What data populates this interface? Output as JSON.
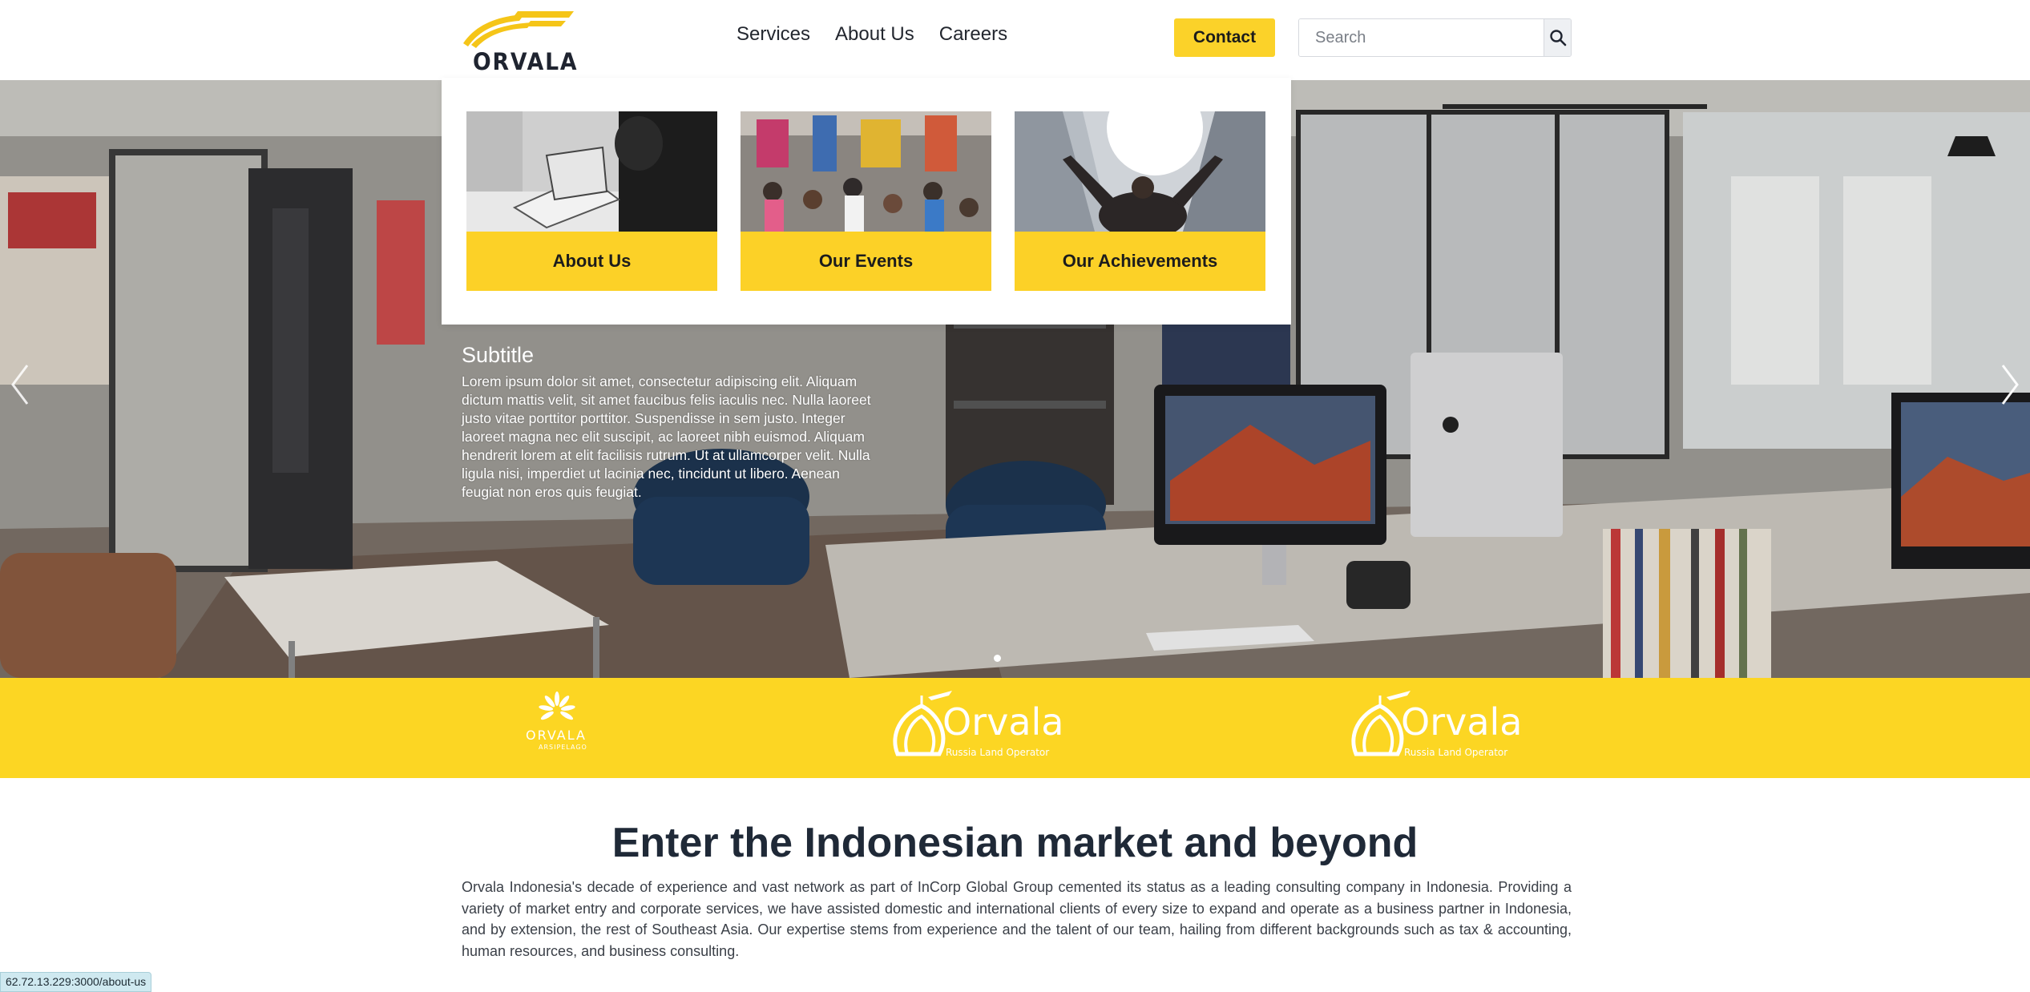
{
  "header": {
    "logo_text": "ORVALA",
    "nav": [
      "Services",
      "About Us",
      "Careers"
    ],
    "contact_label": "Contact",
    "search_placeholder": "Search"
  },
  "dropdown": {
    "cards": [
      {
        "label": "About Us",
        "image": "person-laptop-photo"
      },
      {
        "label": "Our Events",
        "image": "event-crowd-photo"
      },
      {
        "label": "Our Achievements",
        "image": "celebrating-man-skyscrapers-photo"
      }
    ]
  },
  "hero": {
    "subtitle": "Subtitle",
    "text": "Lorem ipsum dolor sit amet, consectetur adipiscing elit. Aliquam dictum mattis velit, sit amet faucibus felis iaculis nec. Nulla laoreet justo vitae porttitor porttitor. Suspendisse in sem justo. Integer laoreet magna nec elit suscipit, ac laoreet nibh euismod. Aliquam hendrerit lorem at elit facilisis rutrum. Ut at ullamcorper velit. Nulla ligula nisi, imperdiet ut lacinia nec, tincidunt ut libero. Aenean feugiat non eros quis feugiat.",
    "slide_count": 1,
    "active_slide": 1
  },
  "partners": [
    {
      "name": "ORVALA",
      "sub": "ARSIPELAGO",
      "icon": "sun-flower-logo"
    },
    {
      "name": "Orvala",
      "sub": "Russia Land Operator",
      "icon": "onion-dome-plane-logo"
    },
    {
      "name": "Orvala",
      "sub": "Russia Land Operator",
      "icon": "onion-dome-plane-logo"
    }
  ],
  "intro": {
    "title": "Enter the Indonesian market and beyond",
    "text": "Orvala Indonesia's decade of experience and vast network as part of InCorp Global Group cemented its status as a leading consulting company in Indonesia. Providing a variety of market entry and corporate services, we have assisted domestic and international clients of every size to expand and operate as a business partner in Indonesia, and by extension, the rest of Southeast Asia. Our expertise stems from experience and the talent of our team, hailing from different backgrounds such as tax & accounting, human resources, and business consulting."
  },
  "status_bar": {
    "url": "62.72.13.229:3000/about-us"
  },
  "colors": {
    "accent": "#fcd127",
    "text_dark": "#1f2937"
  }
}
